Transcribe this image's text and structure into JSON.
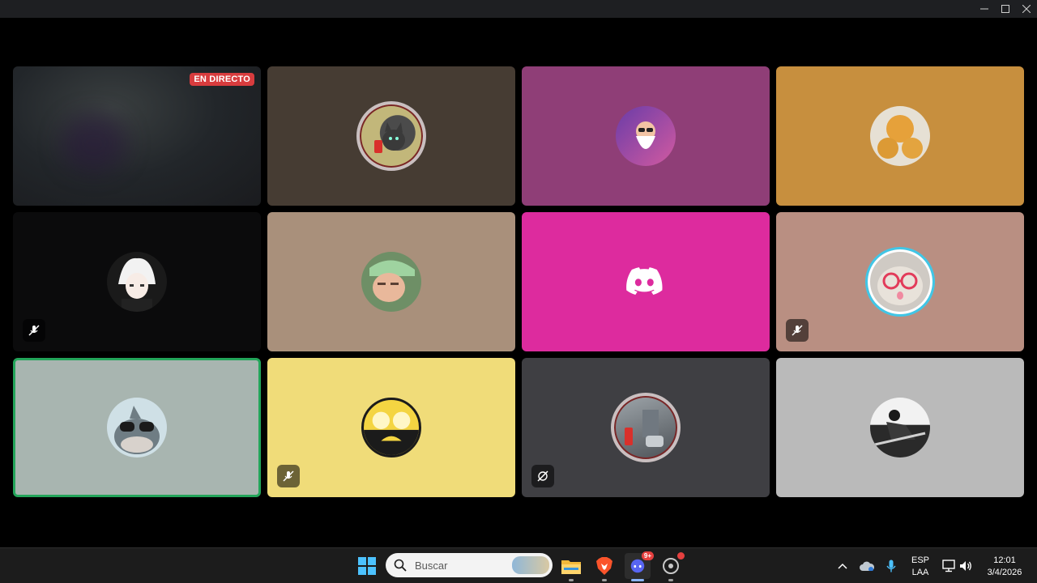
{
  "window": {
    "controls": [
      "minimize-icon",
      "maximize-icon",
      "close-icon"
    ]
  },
  "tiles": [
    {
      "id": "stream",
      "bg": "#25282a",
      "live_label": "EN DIRECTO"
    },
    {
      "id": "user-2",
      "bg": "#463c33",
      "avatar": "cat-avatar-with-decoration"
    },
    {
      "id": "user-3",
      "bg": "#8f3e77",
      "avatar": "old-man-avatar"
    },
    {
      "id": "user-4",
      "bg": "#c78f3e",
      "avatar": "bread-avatar"
    },
    {
      "id": "user-5",
      "bg": "#0b0b0c",
      "avatar": "anime-avatar",
      "status": "muted-mic-icon"
    },
    {
      "id": "user-6",
      "bg": "#a9907b",
      "avatar": "selfie-avatar"
    },
    {
      "id": "user-7",
      "bg": "#dd2b9e",
      "avatar": "discord-logo-icon"
    },
    {
      "id": "user-8",
      "bg": "#b98f82",
      "avatar": "cat-glasses-avatar",
      "status": "muted-mic-icon",
      "speaking_ring": true
    },
    {
      "id": "user-9",
      "bg": "#a8b5b0",
      "avatar": "shark-avatar",
      "speaking": true
    },
    {
      "id": "user-10",
      "bg": "#f0dc79",
      "avatar": "smiley-face-avatar",
      "status": "muted-mic-icon"
    },
    {
      "id": "user-11",
      "bg": "#3f3f43",
      "avatar": "room-avatar-with-decoration",
      "status": "camera-off-icon"
    },
    {
      "id": "user-12",
      "bg": "#bababa",
      "avatar": "bw-photo-avatar"
    }
  ],
  "taskbar": {
    "search_placeholder": "Buscar",
    "apps": [
      "windows-start-icon",
      "file-explorer-icon",
      "brave-browser-icon",
      "discord-app-icon",
      "settings-app-icon"
    ],
    "discord_badge": "9+",
    "lang_top": "ESP",
    "lang_bottom": "LAA",
    "time": "12:01",
    "date": "3/4/2026"
  }
}
